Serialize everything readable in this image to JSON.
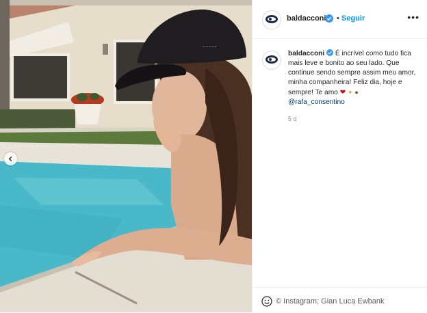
{
  "header": {
    "username": "baldacconi",
    "separator": "•",
    "follow_label": "Seguir",
    "more_label": "•••"
  },
  "caption": {
    "username": "baldacconi",
    "text": "É incrível como tudo fica mais leve e bonito ao seu lado. Que continue sendo sempre assim meu amor, minha companheira! Feliz dia, hoje e sempre! Te amo",
    "emojis": [
      "heart",
      "sparkle",
      "handshake"
    ],
    "mention": "@rafa_consentino",
    "timestamp": "5 d"
  },
  "credit": "© Instagram; Gian Luca Ewbank",
  "colors": {
    "link_blue": "#0095f6",
    "verified_blue": "#3897f0",
    "mention_navy": "#00376b",
    "muted_gray": "#8e8e8e",
    "pool_water": "#4fbfcf",
    "heart_red": "#d0021b"
  },
  "icons": {
    "verified": "verified-badge-icon",
    "more": "more-options-icon",
    "prev": "chevron-left-icon",
    "smile": "smile-icon"
  }
}
